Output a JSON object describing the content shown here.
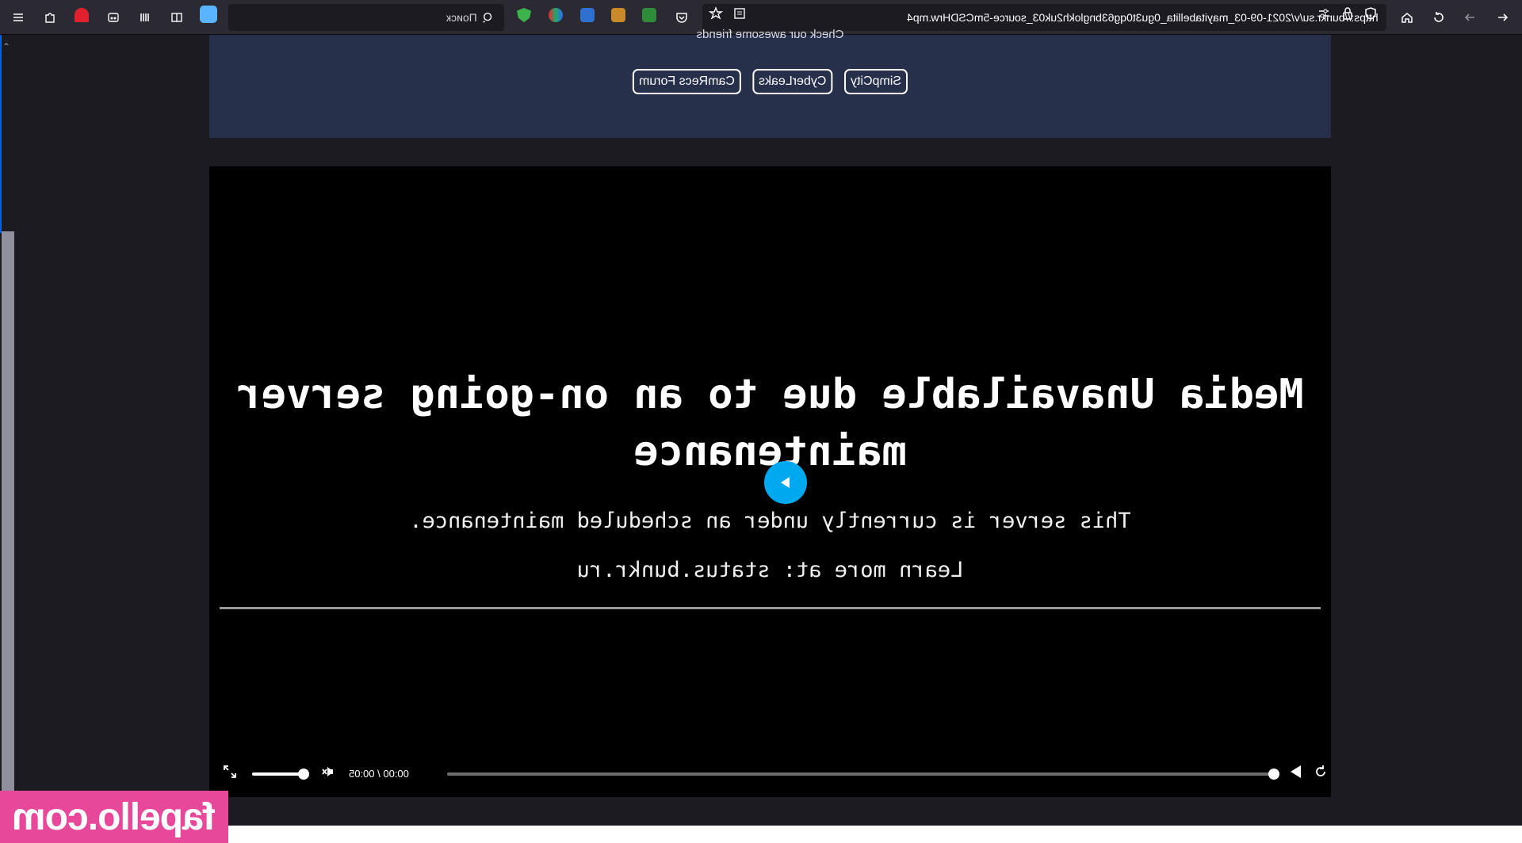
{
  "browser": {
    "url": "https://bunkr.su/v/2021-09-03_mayitabellita_0gu3t0qg63bnglokh2uk03_source-5mCSDHrw.mp4",
    "search_placeholder": "Поиск"
  },
  "banner": {
    "cut_text": "Check our awesome friends",
    "links": [
      "SimpCity",
      "CyberLeaks",
      "CamRecs Forum"
    ]
  },
  "player": {
    "title": "Media Unavailable due to an on-going server maintenance",
    "subtitle": "This server is currently under an scheduled maintenance.",
    "learn_more": "Learn more at: status.bunkr.ru",
    "time": "00:00 / 00:05",
    "progress": 0,
    "volume": 0.85
  },
  "watermark": "fapello.com",
  "colors": {
    "accent": "#00a8f0",
    "banner_bg": "#27304a",
    "watermark_bg": "#e8489a"
  }
}
